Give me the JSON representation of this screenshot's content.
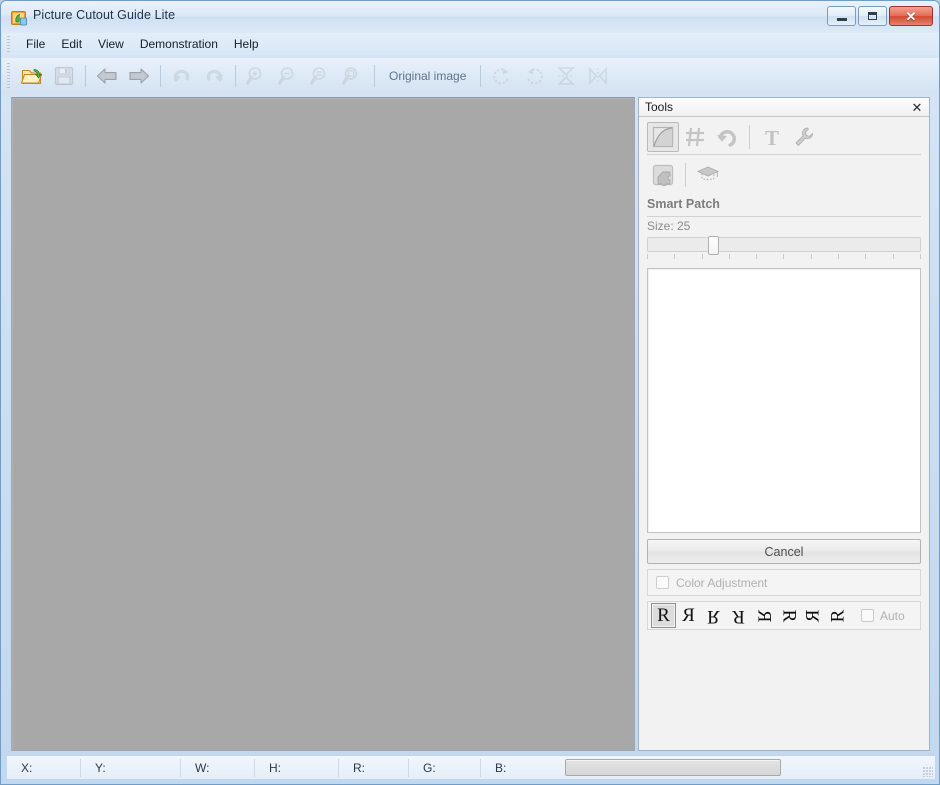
{
  "window": {
    "title": "Picture Cutout Guide Lite",
    "app_icon": "app-logo-icon",
    "controls": {
      "minimize": "minimize-icon",
      "maximize": "maximize-icon",
      "close": "✕"
    }
  },
  "menubar": {
    "items": [
      {
        "label": "File"
      },
      {
        "label": "Edit"
      },
      {
        "label": "View"
      },
      {
        "label": "Demonstration"
      },
      {
        "label": "Help"
      }
    ]
  },
  "toolbar": {
    "buttons": [
      {
        "name": "open-folder-icon",
        "title": "Open"
      },
      {
        "name": "save-disk-icon",
        "title": "Save"
      },
      {
        "name": "arrow-left-icon",
        "title": "Back"
      },
      {
        "name": "arrow-right-icon",
        "title": "Forward"
      },
      {
        "name": "undo-icon",
        "title": "Undo"
      },
      {
        "name": "redo-icon",
        "title": "Redo"
      },
      {
        "name": "zoom-in-icon",
        "title": "Zoom In"
      },
      {
        "name": "zoom-out-icon",
        "title": "Zoom Out"
      },
      {
        "name": "zoom-fit-icon",
        "title": "Fit"
      },
      {
        "name": "zoom-actual-icon",
        "title": "Actual Size"
      },
      {
        "name": "rotate-cw-icon",
        "title": "Rotate Clockwise"
      },
      {
        "name": "rotate-ccw-icon",
        "title": "Rotate Counter-clockwise"
      },
      {
        "name": "flip-vertical-icon",
        "title": "Flip Vertical"
      },
      {
        "name": "flip-horizontal-icon",
        "title": "Flip Horizontal"
      }
    ],
    "original_image_label": "Original image"
  },
  "panel": {
    "title": "Tools",
    "close_glyph": "✕",
    "tools_row1": [
      {
        "name": "cutout-tool-icon",
        "selected": true
      },
      {
        "name": "grid-tool-icon",
        "selected": false
      },
      {
        "name": "undo-tool-icon",
        "selected": false
      },
      {
        "name": "text-tool-icon",
        "selected": false
      },
      {
        "name": "settings-wrench-icon",
        "selected": false
      }
    ],
    "tools_row2": [
      {
        "name": "smart-patch-tool-icon",
        "selected": false
      },
      {
        "name": "tutorial-cap-icon",
        "selected": false
      }
    ],
    "section_title": "Smart Patch",
    "size": {
      "label": "Size: 25",
      "value": 25,
      "min": 1,
      "max": 100,
      "tick_count": 11
    },
    "listbox_items": [],
    "cancel_label": "Cancel",
    "color_adjustment": {
      "label": "Color Adjustment",
      "checked": false,
      "enabled": false
    },
    "orientation": {
      "glyph": "R",
      "options": [
        {
          "name": "orientation-normal",
          "active": true
        },
        {
          "name": "orientation-flip-horizontal",
          "active": false
        },
        {
          "name": "orientation-rotate-180-flip",
          "active": false
        },
        {
          "name": "orientation-rotate-180",
          "active": false
        },
        {
          "name": "orientation-rotate-90-flip",
          "active": false
        },
        {
          "name": "orientation-rotate-90",
          "active": false
        },
        {
          "name": "orientation-rotate-270-flip",
          "active": false
        },
        {
          "name": "orientation-rotate-270",
          "active": false
        }
      ],
      "auto_label": "Auto",
      "auto_checked": false
    }
  },
  "statusbar": {
    "fields": [
      {
        "label": "X:"
      },
      {
        "label": "Y:"
      },
      {
        "label": "W:"
      },
      {
        "label": "H:"
      },
      {
        "label": "R:"
      },
      {
        "label": "G:"
      },
      {
        "label": "B:"
      }
    ],
    "progress_value": 0
  },
  "colors": {
    "canvas": "#a8a8a8",
    "panel_bg": "#f2f2f2",
    "accent": "#7eb4ea",
    "close_red": "#d24a30"
  }
}
